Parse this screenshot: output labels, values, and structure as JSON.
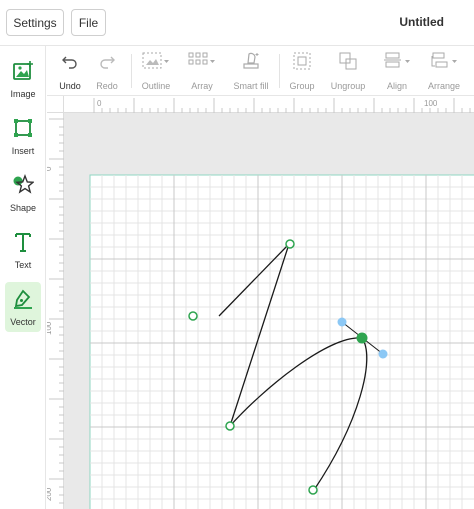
{
  "header": {
    "settings_label": "Settings",
    "file_label": "File",
    "document_title": "Untitled"
  },
  "left_tools": [
    {
      "label": "Image",
      "icon": "image-icon",
      "active": false
    },
    {
      "label": "Insert",
      "icon": "insert-icon",
      "active": false
    },
    {
      "label": "Shape",
      "icon": "shape-icon",
      "active": false
    },
    {
      "label": "Text",
      "icon": "text-icon",
      "active": false
    },
    {
      "label": "Vector",
      "icon": "pen-icon",
      "active": true
    }
  ],
  "toolbar": {
    "undo_label": "Undo",
    "redo_label": "Redo",
    "outline_label": "Outline",
    "array_label": "Array",
    "smart_fill_label": "Smart fill",
    "group_label": "Group",
    "ungroup_label": "Ungroup",
    "align_label": "Align",
    "arrange_label": "Arrange"
  },
  "rulers": {
    "top_ticks": [
      "0",
      "100"
    ],
    "left_ticks": [
      "0",
      "100",
      "200"
    ]
  },
  "colors": {
    "accent": "#2ea44f",
    "active_tool_bg": "#dff5dc",
    "handle_blue": "#8cc8f5",
    "canvas_border": "#8fd6c2",
    "workspace": "#e9e9e9"
  }
}
